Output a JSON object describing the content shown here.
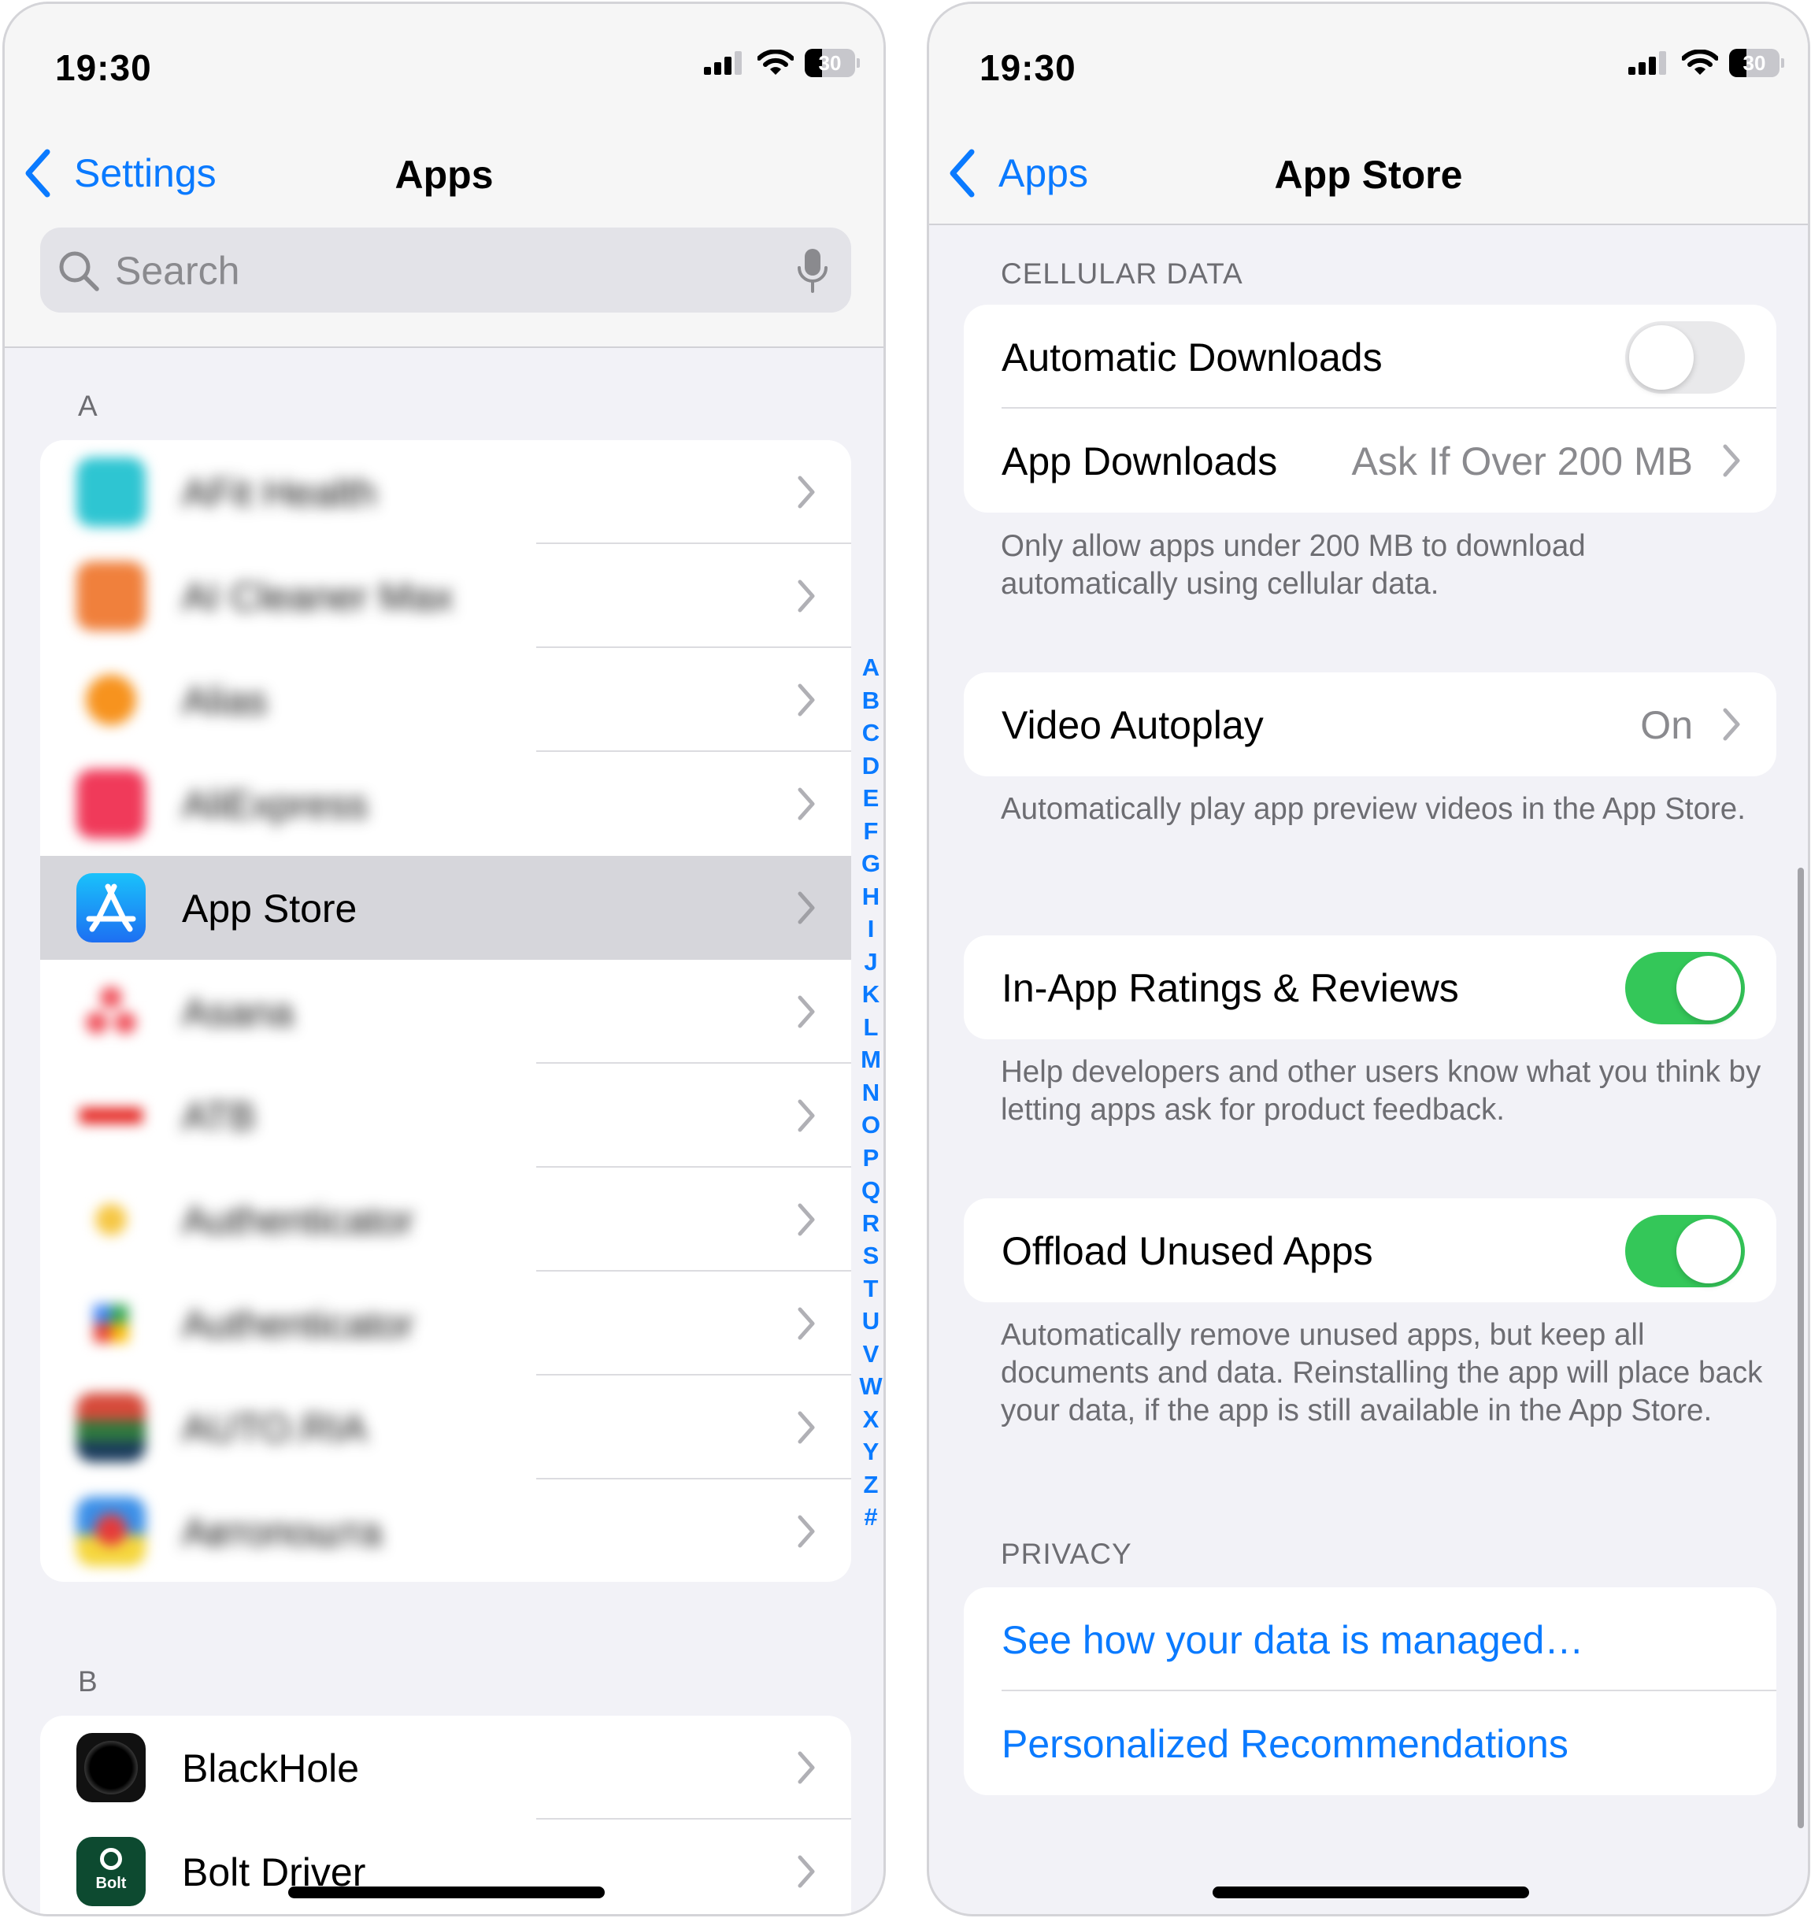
{
  "left": {
    "status": {
      "time": "19:30",
      "battery": "30"
    },
    "nav": {
      "back_label": "Settings",
      "title": "Apps"
    },
    "search": {
      "placeholder": "Search"
    },
    "section_a": {
      "header": "A",
      "items": [
        {
          "label": "AFit Health",
          "icon": "afit-health-app-icon",
          "blurred": true
        },
        {
          "label": "AI Cleaner Max",
          "icon": "ai-cleaner-app-icon",
          "blurred": true
        },
        {
          "label": "Alias",
          "icon": "alias-app-icon",
          "blurred": true
        },
        {
          "label": "AliExpress",
          "icon": "aliexpress-app-icon",
          "blurred": true
        },
        {
          "label": "App Store",
          "icon": "app-store-app-icon",
          "blurred": false,
          "selected": true
        },
        {
          "label": "Asana",
          "icon": "asana-app-icon",
          "blurred": true
        },
        {
          "label": "ATB",
          "icon": "atb-app-icon",
          "blurred": true
        },
        {
          "label": "Authenticator",
          "icon": "authenticator-app-icon",
          "blurred": true
        },
        {
          "label": "Authenticator",
          "icon": "google-authenticator-app-icon",
          "blurred": true
        },
        {
          "label": "AUTO.RIA",
          "icon": "auto-ria-app-icon",
          "blurred": true
        },
        {
          "label": "Автопошта",
          "icon": "avtoposhta-app-icon",
          "blurred": true
        }
      ]
    },
    "section_b": {
      "header": "B",
      "items": [
        {
          "label": "BlackHole",
          "icon": "blackhole-app-icon"
        },
        {
          "label": "Bolt Driver",
          "icon": "bolt-driver-app-icon",
          "icon_text": "Bolt"
        }
      ]
    },
    "index": [
      "A",
      "B",
      "C",
      "D",
      "E",
      "F",
      "G",
      "H",
      "I",
      "J",
      "K",
      "L",
      "M",
      "N",
      "O",
      "P",
      "Q",
      "R",
      "S",
      "T",
      "U",
      "V",
      "W",
      "X",
      "Y",
      "Z",
      "#"
    ]
  },
  "right": {
    "status": {
      "time": "19:30",
      "battery": "30"
    },
    "nav": {
      "back_label": "Apps",
      "title": "App Store"
    },
    "cellular": {
      "header": "CELLULAR DATA",
      "automatic_downloads": {
        "label": "Automatic Downloads",
        "on": false
      },
      "app_downloads": {
        "label": "App Downloads",
        "value": "Ask If Over 200 MB"
      },
      "footer": "Only allow apps under 200 MB to download automatically using cellular data."
    },
    "video": {
      "label": "Video Autoplay",
      "value": "On",
      "footer": "Automatically play app preview videos in the App Store."
    },
    "ratings": {
      "label": "In-App Ratings & Reviews",
      "on": true,
      "footer": "Help developers and other users know what you think by letting apps ask for product feedback."
    },
    "offload": {
      "label": "Offload Unused Apps",
      "on": true,
      "footer": "Automatically remove unused apps, but keep all documents and data. Reinstalling the app will place back your data, if the app is still available in the App Store."
    },
    "privacy": {
      "header": "PRIVACY",
      "links": [
        "See how your data is managed…",
        "Personalized Recommendations"
      ]
    }
  },
  "colors": {
    "accent": "#0a7aff",
    "toggle_on": "#34c759",
    "toggle_off": "#e9e9eb",
    "background": "#f2f2f7",
    "selected_row": "#d6d6db"
  }
}
